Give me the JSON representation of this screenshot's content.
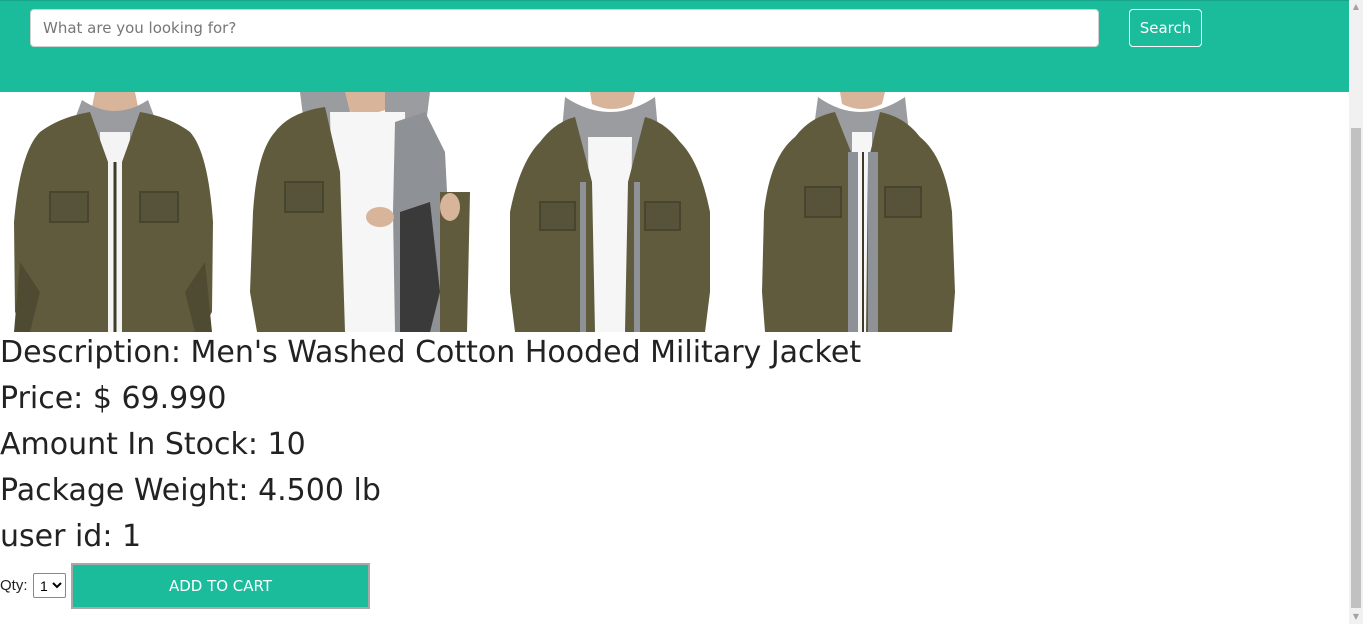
{
  "search": {
    "placeholder": "What are you looking for?",
    "button_label": "Search"
  },
  "product": {
    "images": [
      "jacket-front-icon",
      "jacket-open-lining-icon",
      "jacket-hood-front-icon",
      "jacket-zipped-icon"
    ],
    "description_label": "Description:",
    "description": "Men's Washed Cotton Hooded Military Jacket",
    "price_label": "Price:",
    "price": "$ 69.990",
    "stock_label": "Amount In Stock:",
    "stock": "10",
    "weight_label": "Package Weight:",
    "weight": "4.500 lb",
    "user_id_label": "user id:",
    "user_id": "1"
  },
  "cart": {
    "qty_label": "Qty:",
    "qty_value": "1",
    "add_label": "ADD TO CART"
  },
  "colors": {
    "accent": "#1abc9c",
    "jacket": "#5f5b3c",
    "hood": "#8e9196"
  }
}
